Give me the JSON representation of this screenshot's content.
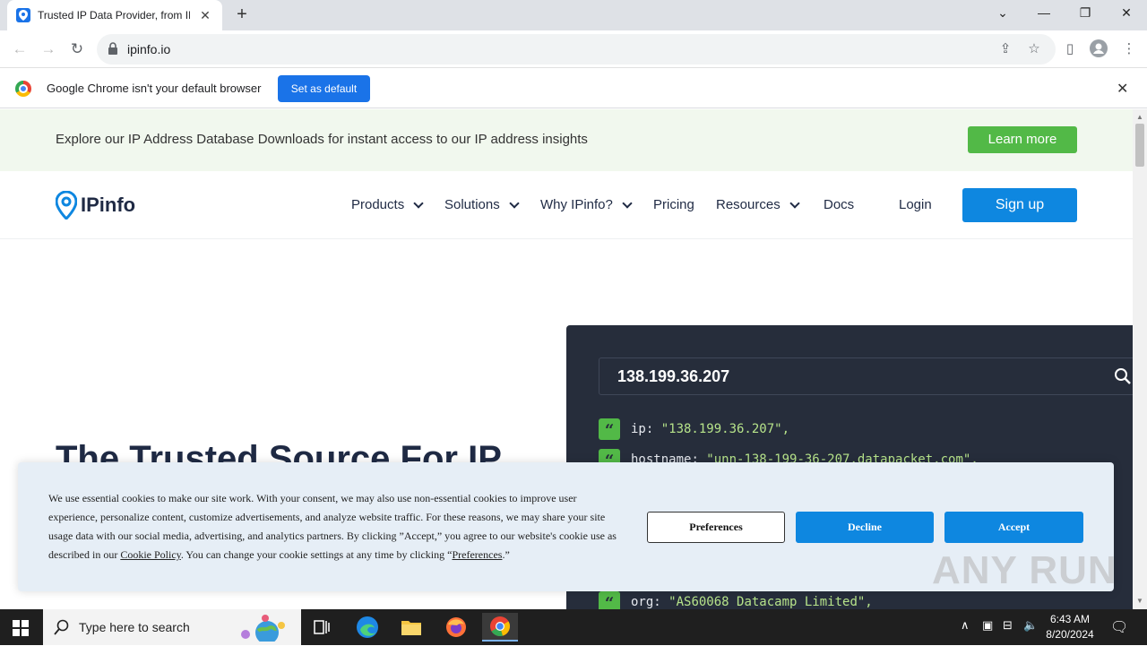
{
  "browser": {
    "tab_title": "Trusted IP Data Provider, from IP",
    "url": "ipinfo.io",
    "infobar_text": "Google Chrome isn't your default browser",
    "set_default_label": "Set as default"
  },
  "promo": {
    "text": "Explore our IP Address Database Downloads for instant access to our IP address insights",
    "learn_more": "Learn more"
  },
  "nav": {
    "logo": "IPinfo",
    "items": [
      "Products",
      "Solutions",
      "Why IPinfo?",
      "Pricing",
      "Resources",
      "Docs"
    ],
    "login": "Login",
    "signup": "Sign up"
  },
  "hero": {
    "title": "The Trusted Source For IP"
  },
  "lookup": {
    "ip": "138.199.36.207",
    "lines": [
      {
        "key": "ip",
        "value": "\"138.199.36.207\","
      },
      {
        "key": "hostname",
        "value": "\"unn-138-199-36-207.datapacket.com\","
      },
      {
        "key": "org",
        "value": "\"AS60068 Datacamp Limited\","
      }
    ]
  },
  "cookie": {
    "text_1": "We use essential cookies to make our site work. With your consent, we may also use non-essential cookies to improve user experience, personalize content, customize advertisements, and analyze website traffic. For these reasons, we may share your site usage data with our social media, advertising, and analytics partners. By clicking ”Accept,” you agree to our website's cookie use as described in our ",
    "policy_link": "Cookie Policy",
    "text_2": ". You can change your cookie settings at any time by clicking “",
    "preferences_link": "Preferences",
    "text_3": ".”",
    "preferences_btn": "Preferences",
    "decline_btn": "Decline",
    "accept_btn": "Accept"
  },
  "watermark": "ANY RUN",
  "taskbar": {
    "search_placeholder": "Type here to search",
    "time": "6:43 AM",
    "date": "8/20/2024"
  },
  "colors": {
    "brand_blue": "#0e87e0",
    "brand_green": "#52b947",
    "chrome_blue": "#1a73e8",
    "code_bg": "#262d3b"
  }
}
